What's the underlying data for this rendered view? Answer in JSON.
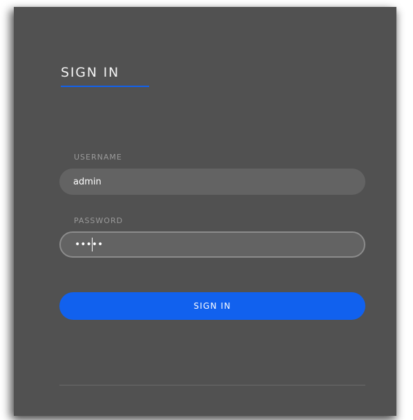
{
  "form": {
    "title": "SIGN IN",
    "username": {
      "label": "USERNAME",
      "value": "admin"
    },
    "password": {
      "label": "PASSWORD",
      "value": ".....",
      "masked_display": "·····"
    },
    "submit_label": "SIGN IN"
  },
  "colors": {
    "card_background": "#515151",
    "input_background": "#636363",
    "accent": "#1161ee",
    "label_text": "#9a9a9a",
    "text": "#ffffff"
  }
}
